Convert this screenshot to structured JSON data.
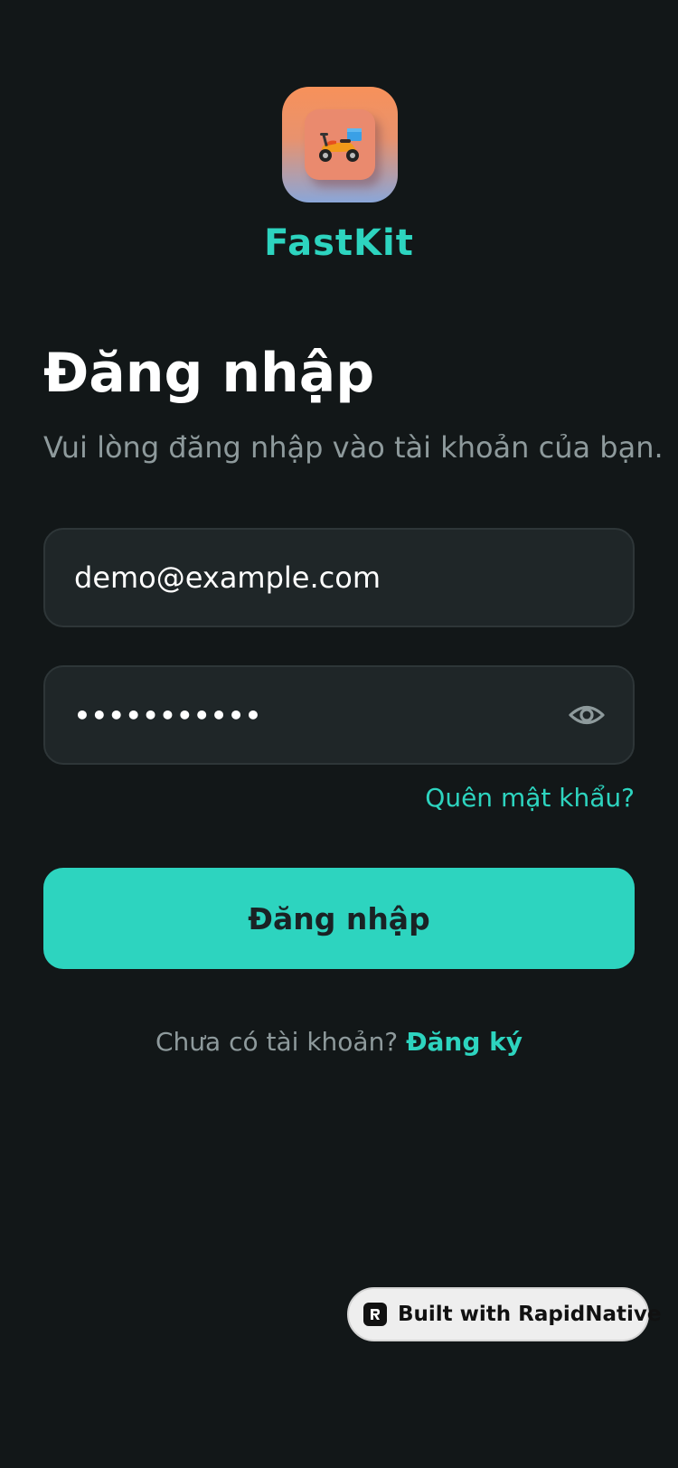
{
  "app": {
    "brand_name": "FastKit",
    "icon": "scooter-icon"
  },
  "login": {
    "title": "Đăng nhập",
    "subtitle": "Vui lòng đăng nhập vào tài khoản của bạn.",
    "email_value": "demo@example.com",
    "password_value": "•••••••••••",
    "forgot_label": "Quên mật khẩu?",
    "submit_label": "Đăng nhập",
    "signup_prompt": "Chưa có tài khoản?",
    "signup_link": "Đăng ký"
  },
  "badge": {
    "label": "Built with RapidNative",
    "icon": "rapidnative-logo-icon"
  },
  "colors": {
    "background": "#121718",
    "accent": "#2dd4bf",
    "field_bg": "#1f2628",
    "muted_text": "#8e9a9c"
  }
}
